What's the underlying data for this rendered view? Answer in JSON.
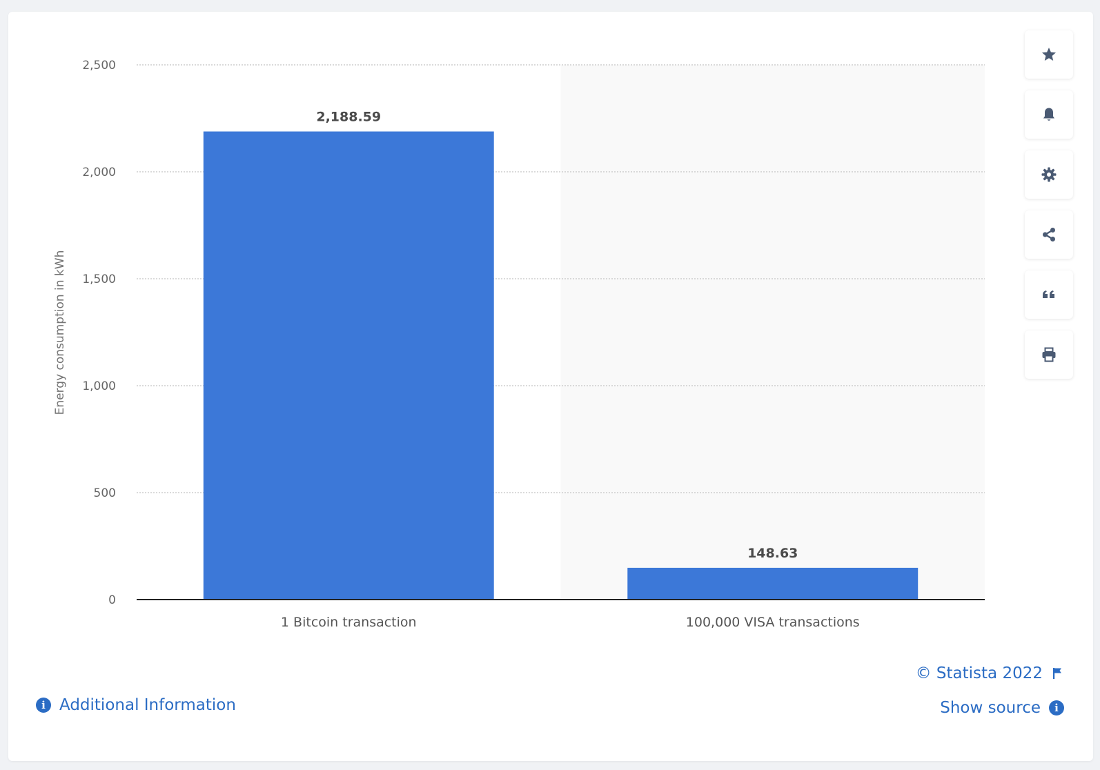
{
  "chart_data": {
    "type": "bar",
    "categories": [
      "1 Bitcoin transaction",
      "100,000 VISA transactions"
    ],
    "values": [
      2188.59,
      148.63
    ],
    "value_labels": [
      "2,188.59",
      "148.63"
    ],
    "title": "",
    "xlabel": "",
    "ylabel": "Energy consumption in kWh",
    "ylim": [
      0,
      2500
    ],
    "yticks": [
      0,
      500,
      1000,
      1500,
      2000,
      2500
    ],
    "ytick_labels": [
      "0",
      "500",
      "1,000",
      "1,500",
      "2,000",
      "2,500"
    ],
    "grid": true,
    "bar_color": "#3c78d8"
  },
  "toolbar": {
    "buttons": [
      {
        "name": "favorite",
        "icon": "star-icon"
      },
      {
        "name": "notification",
        "icon": "bell-icon"
      },
      {
        "name": "settings",
        "icon": "gear-icon"
      },
      {
        "name": "share",
        "icon": "share-icon"
      },
      {
        "name": "cite",
        "icon": "quote-icon"
      },
      {
        "name": "print",
        "icon": "printer-icon"
      }
    ]
  },
  "footer": {
    "additional_info": "Additional Information",
    "copyright": "© Statista 2022",
    "show_source": "Show source",
    "link_color": "#2b6cc4"
  }
}
